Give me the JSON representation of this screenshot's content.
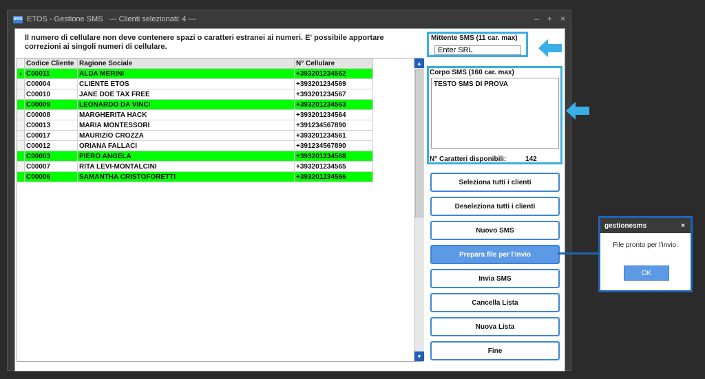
{
  "window": {
    "app_icon": "SMS",
    "title": "ETOS - Gestione SMS   --- Clienti selezionati: 4 ---",
    "controls": [
      "–",
      "+",
      "×"
    ]
  },
  "info_text": "Il numero di cellulare non deve contenere spazi o caratteri estranei ai numeri. E' possibile apportare correzioni ai singoli numeri di cellulare.",
  "grid": {
    "columns": [
      "Codice Cliente",
      "Ragione Sociale",
      "N° Cellulare"
    ],
    "current_row_marker": "›",
    "rows": [
      {
        "code": "C00011",
        "name": "ALDA MERINI",
        "phone": "+393201234562",
        "selected": true
      },
      {
        "code": "C00004",
        "name": "CLIENTE ETOS",
        "phone": "+393201234569",
        "selected": false
      },
      {
        "code": "C00010",
        "name": "JANE DOE TAX FREE",
        "phone": "+393201234567",
        "selected": false
      },
      {
        "code": "C00009",
        "name": "LEONARDO DA VINCI",
        "phone": "+393201234563",
        "selected": true
      },
      {
        "code": "C00008",
        "name": "MARGHERITA HACK",
        "phone": "+393201234564",
        "selected": false
      },
      {
        "code": "C00013",
        "name": "MARIA  MONTESSORI",
        "phone": "+391234567890",
        "selected": false
      },
      {
        "code": "C00017",
        "name": "MAURIZIO CROZZA",
        "phone": "+393201234561",
        "selected": false
      },
      {
        "code": "C00012",
        "name": "ORIANA  FALLACI",
        "phone": "+391234567890",
        "selected": false
      },
      {
        "code": "C00003",
        "name": "PIERO ANGELA",
        "phone": "+393201234568",
        "selected": true
      },
      {
        "code": "C00007",
        "name": "RITA LEVI-MONTALCINI",
        "phone": "+393201234565",
        "selected": false
      },
      {
        "code": "C00006",
        "name": "SAMANTHA CRISTOFORETTI",
        "phone": "+393201234566",
        "selected": true
      }
    ]
  },
  "sender": {
    "label": "Mittente SMS (11 car. max)",
    "value": "Enter SRL"
  },
  "body": {
    "label": "Corpo SMS (160 car. max)",
    "value": "TESTO SMS DI PROVA",
    "chars_label": "N° Caratteri disponibili:",
    "chars_value": "142"
  },
  "buttons": {
    "select_all": "Seleziona tutti i clienti",
    "deselect_all": "Deseleziona tutti i clienti",
    "new_sms": "Nuovo SMS",
    "prepare": "Prepara file per l'invio",
    "send": "Invia SMS",
    "clear": "Cancella Lista",
    "new_list": "Nuova Lista",
    "end": "Fine"
  },
  "dialog": {
    "title": "gestionesms",
    "close": "×",
    "message": "File pronto per l'invio.",
    "ok": "OK"
  },
  "colors": {
    "highlight": "#00ff00",
    "accent": "#3aaee6",
    "button_active": "#5c9ae6",
    "dialog_border": "#1e64b4"
  }
}
